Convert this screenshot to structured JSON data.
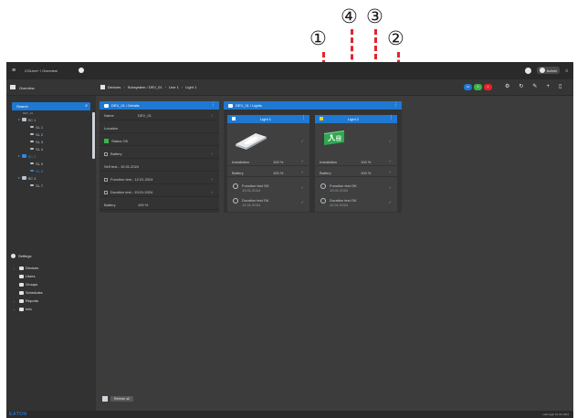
{
  "callouts": [
    "①",
    "②",
    "③",
    "④"
  ],
  "topbar": {
    "app_title": "CGLine+ / Overview",
    "user_label": "Admin"
  },
  "subbar": {
    "label": "Overview"
  },
  "breadcrumb": [
    "Devices",
    "Subsystem / DEV_01",
    "Line 1",
    "Light 1"
  ],
  "badges": [
    {
      "text": "12",
      "color": "#1f78d1"
    },
    {
      "text": "3",
      "color": "#39b54a"
    },
    {
      "text": "1",
      "color": "#e5232c"
    }
  ],
  "sidebar": {
    "search_placeholder": "Search",
    "search_sub": "DEV_01",
    "tree": [
      {
        "label": "SC 1",
        "level": 1,
        "icon": "device",
        "open": true,
        "selected": false
      },
      {
        "label": "SL 1",
        "level": 2,
        "icon": "light",
        "selected": false
      },
      {
        "label": "SL 2",
        "level": 2,
        "icon": "light",
        "selected": false
      },
      {
        "label": "SL 3",
        "level": 2,
        "icon": "light",
        "selected": false
      },
      {
        "label": "SL 4",
        "level": 2,
        "icon": "light",
        "selected": false
      },
      {
        "label": "SC 2",
        "level": 1,
        "icon": "device",
        "open": true,
        "selected": true
      },
      {
        "label": "SL 5",
        "level": 2,
        "icon": "light",
        "selected": false
      },
      {
        "label": "SL 6",
        "level": 2,
        "icon": "light",
        "selected": true
      },
      {
        "label": "SC 3",
        "level": 1,
        "icon": "device",
        "open": true,
        "selected": false
      },
      {
        "label": "SL 7",
        "level": 2,
        "icon": "light",
        "selected": false
      }
    ],
    "section_title": "Settings",
    "nav": [
      {
        "label": "Devices",
        "has_caret": true
      },
      {
        "label": "Users",
        "has_caret": false
      },
      {
        "label": "Groups",
        "has_caret": false
      },
      {
        "label": "Schedules",
        "has_caret": false
      },
      {
        "label": "Reports",
        "has_caret": true
      },
      {
        "label": "Info",
        "has_caret": true
      }
    ]
  },
  "left_panel": {
    "title": "DEV_01 / Details",
    "rows": [
      {
        "label": "Name",
        "value": "DEV_01",
        "check": true,
        "kind": "plain"
      },
      {
        "label": "Location",
        "value": "",
        "check": false,
        "kind": "plain"
      },
      {
        "label": "Status OK",
        "value": "",
        "check": false,
        "kind": "green"
      },
      {
        "label": "Battery",
        "value": "",
        "check": true,
        "kind": "toggle"
      },
      {
        "label": "Self test - 10.01.2024",
        "value": "",
        "check": false,
        "kind": "plain"
      },
      {
        "label": "Function test - 12.01.2024",
        "value": "",
        "check": true,
        "kind": "box"
      },
      {
        "label": "Duration test - 15.01.2024",
        "value": "",
        "check": true,
        "kind": "box"
      },
      {
        "label": "Battery",
        "value": "100 %",
        "check": false,
        "kind": "plain"
      }
    ]
  },
  "right_panel": {
    "title": "DEV_01 / Lights",
    "cards": [
      {
        "title": "Light 1",
        "icon_type": "luminaire",
        "rows": [
          {
            "label": "Installation",
            "value": "100 %"
          },
          {
            "label": "Battery",
            "value": "100 %"
          }
        ],
        "functions": [
          {
            "l1": "Function test OK",
            "l2": "10.01.2024"
          },
          {
            "l1": "Duration test OK",
            "l2": "12.01.2024"
          }
        ]
      },
      {
        "title": "Light 2",
        "icon_type": "exit-sign",
        "rows": [
          {
            "label": "Installation",
            "value": "100 %"
          },
          {
            "label": "Battery",
            "value": "100 %"
          }
        ],
        "functions": [
          {
            "l1": "Function test OK",
            "l2": "10.01.2024"
          },
          {
            "l1": "Duration test OK",
            "l2": "12.01.2024"
          }
        ]
      }
    ]
  },
  "footer": {
    "button_label": "Refresh all"
  },
  "statusbar": {
    "logo": "EATON",
    "login_text": "Last login 01.01.2024"
  },
  "colors": {
    "accent": "#1f78d1",
    "arrow": "#e5232c",
    "ok": "#39b54a"
  }
}
